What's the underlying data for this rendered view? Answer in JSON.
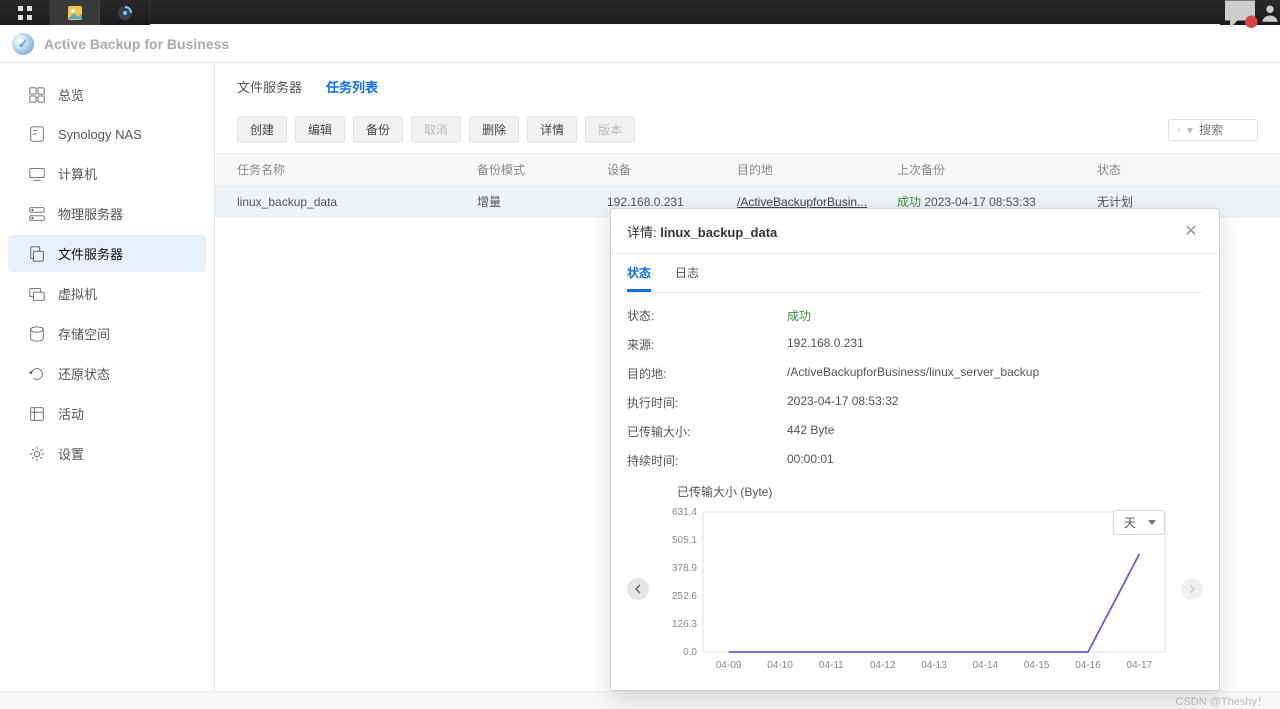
{
  "app": {
    "title": "Active Backup for Business"
  },
  "sidebar": {
    "items": [
      {
        "label": "总览"
      },
      {
        "label": "Synology NAS"
      },
      {
        "label": "计算机"
      },
      {
        "label": "物理服务器"
      },
      {
        "label": "文件服务器"
      },
      {
        "label": "虚拟机"
      },
      {
        "label": "存储空间"
      },
      {
        "label": "还原状态"
      },
      {
        "label": "活动"
      },
      {
        "label": "设置"
      }
    ],
    "active_index": 4
  },
  "subtabs": {
    "items": [
      "文件服务器",
      "任务列表"
    ],
    "active_index": 1
  },
  "toolbar": {
    "create": "创建",
    "edit": "编辑",
    "backup": "备份",
    "cancel": "取消",
    "delete": "删除",
    "details": "详情",
    "version": "版本",
    "search_placeholder": "搜索"
  },
  "grid": {
    "headers": {
      "name": "任务名称",
      "mode": "备份模式",
      "device": "设备",
      "dest": "目的地",
      "last": "上次备份",
      "state": "状态"
    },
    "rows": [
      {
        "name": "linux_backup_data",
        "mode": "增量",
        "device": "192.168.0.231",
        "dest": "/ActiveBackupforBusin...",
        "last_status": "成功",
        "last_time": "2023-04-17 08:53:33",
        "state": "无计划"
      }
    ]
  },
  "modal": {
    "title_prefix": "详情: ",
    "title_name": "linux_backup_data",
    "tabs": [
      "状态",
      "日志"
    ],
    "active_tab": 0,
    "fields": {
      "state_label": "状态:",
      "state_value": "成功",
      "source_label": "来源:",
      "source_value": "192.168.0.231",
      "dest_label": "目的地:",
      "dest_value": "/ActiveBackupforBusiness/linux_server_backup",
      "exec_label": "执行时间:",
      "exec_value": "2023-04-17 08:53:32",
      "size_label": "已传输大小:",
      "size_value": "442 Byte",
      "dur_label": "持续时间:",
      "dur_value": "00:00:01"
    },
    "chart": {
      "title": "已传输大小 (Byte)",
      "dropdown": "天"
    }
  },
  "chart_data": {
    "type": "line",
    "title": "已传输大小 (Byte)",
    "xlabel": "",
    "ylabel": "",
    "ylim": [
      0,
      631.4
    ],
    "y_ticks": [
      0.0,
      126.3,
      252.6,
      378.9,
      505.1,
      631.4
    ],
    "categories": [
      "04-09",
      "04-10",
      "04-11",
      "04-12",
      "04-13",
      "04-14",
      "04-15",
      "04-16",
      "04-17"
    ],
    "values": [
      0,
      0,
      0,
      0,
      0,
      0,
      0,
      0,
      442
    ]
  },
  "watermark": "CSDN @Theshy！"
}
